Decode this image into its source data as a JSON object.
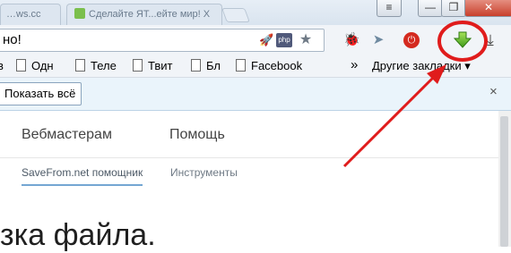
{
  "window": {
    "tabs": [
      {
        "label": "…ws.cc"
      },
      {
        "label": "Сделайте ЯТ...ейте мир! X"
      }
    ],
    "menu_label": "≡",
    "minimize_label": "—",
    "maximize_label": "❐",
    "close_label": "✕"
  },
  "omnibox": {
    "text": "но!"
  },
  "extensions": [
    {
      "icon": "rocket-icon"
    },
    {
      "icon": "php-icon",
      "label": "php"
    },
    {
      "icon": "bookmark-star-icon"
    },
    {
      "icon": "ladybug-icon"
    },
    {
      "icon": "paper-plane-icon"
    },
    {
      "icon": "stop-icon"
    },
    {
      "icon": "savefrom-download-icon"
    },
    {
      "icon": "download-icon"
    }
  ],
  "bookmarks": {
    "items": [
      "в",
      "Одн",
      "Теле",
      "Твит",
      "Бл",
      "Facebook"
    ],
    "overflow": "»",
    "other": "Другие закладки"
  },
  "infobar": {
    "button_label": "Показать всё",
    "close_label": "×"
  },
  "page": {
    "nav": [
      "Вебмастерам",
      "Помощь"
    ],
    "subtabs": [
      "SaveFrom.net помощник",
      "Инструменты"
    ],
    "active_subtab": 0,
    "heading": "зка файла."
  },
  "annotation": {
    "color": "#e01c1c",
    "shape": "circle-with-arrow",
    "target": "savefrom-download-icon"
  }
}
